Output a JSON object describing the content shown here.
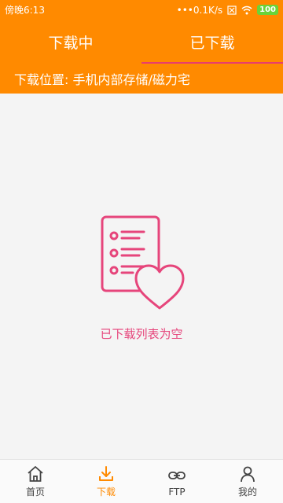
{
  "status_bar": {
    "time": "傍晚6:13",
    "speed": "•••0.1K/s",
    "battery": "100"
  },
  "tabs": [
    {
      "label": "下载中",
      "active": false
    },
    {
      "label": "已下载",
      "active": true
    }
  ],
  "location": {
    "text": "下载位置: 手机内部存储/磁力宅"
  },
  "empty_state": {
    "message": "已下载列表为空"
  },
  "bottom_nav": [
    {
      "label": "首页",
      "icon": "home-icon",
      "active": false
    },
    {
      "label": "下载",
      "icon": "download-icon",
      "active": true
    },
    {
      "label": "FTP",
      "icon": "link-icon",
      "active": false
    },
    {
      "label": "我的",
      "icon": "person-icon",
      "active": false
    }
  ],
  "colors": {
    "accent": "#ff8a00",
    "pink": "#e6457b"
  }
}
